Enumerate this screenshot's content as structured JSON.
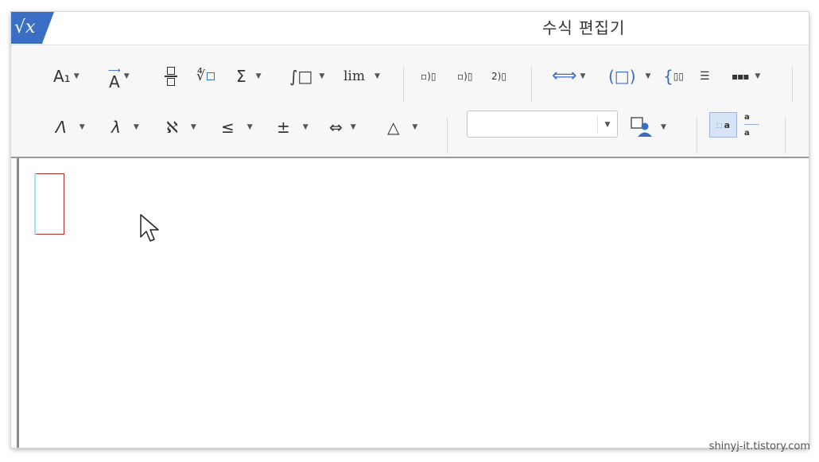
{
  "window": {
    "title": "수식 편집기",
    "logo_text": "√x"
  },
  "toolbar": {
    "row1": {
      "font_size_label": "A₁",
      "decoration_label": "A",
      "sum_label": "Σ",
      "integral_label": "∫□",
      "limit_label": "lim",
      "paren_label": "(□)",
      "brace_label": "{"
    },
    "row2": {
      "greek_upper_label": "Λ",
      "greek_lower_label": "λ",
      "hebrew_label": "ℵ",
      "relation_label": "≤",
      "operator_label": "±",
      "arrow_label": "⇔",
      "misc_label": "△"
    },
    "font_select": {
      "value": ""
    },
    "inline_label": "a",
    "colors": {
      "accent": "#3b6fc6",
      "toggle_bg": "#d7e3f6",
      "placeholder_border": "#b22b2b"
    }
  },
  "watermark": "shinyj-it.tistory.com"
}
